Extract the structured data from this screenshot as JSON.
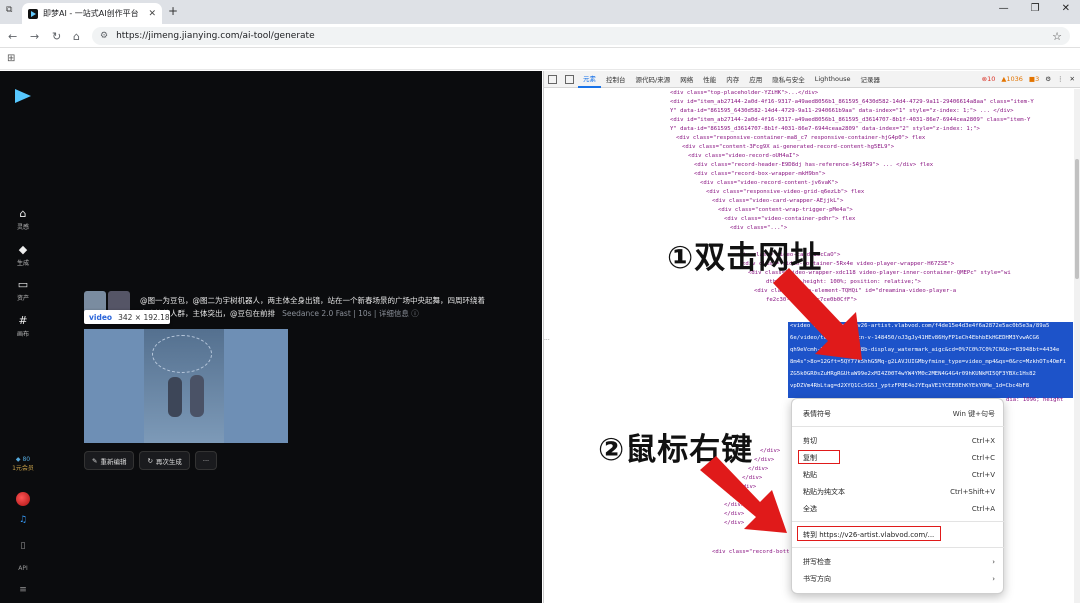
{
  "browser": {
    "tab_title": "即梦AI - 一站式AI创作平台",
    "url": "https://jimeng.jianying.com/ai-tool/generate"
  },
  "sidebar": {
    "items": [
      {
        "icon": "home-icon",
        "label": "灵感"
      },
      {
        "icon": "sparkle-icon",
        "label": "生成"
      },
      {
        "icon": "folder-icon",
        "label": "资产"
      },
      {
        "icon": "canvas-icon",
        "label": "画布"
      }
    ],
    "credits_value": "80",
    "credits_label": "1元会员",
    "api_label": "API"
  },
  "generation": {
    "prompt": "@图一为豆包，@图二为宇树机器人，两主体全身出镜，站在一个新春场景的广场中央起舞，四周环绕着喜欢笑的人群，主体突出，@豆包在前排",
    "model": "Seedance 2.0 Fast",
    "duration": "10s",
    "details_label": "详细信息",
    "tooltip_tag": "video",
    "tooltip_size": "342 × 192.18",
    "actions": [
      "重新编辑",
      "再次生成",
      "···"
    ]
  },
  "devtools": {
    "tabs": [
      "元素",
      "控制台",
      "源代码/来源",
      "网络",
      "性能",
      "内存",
      "应用",
      "隐私与安全",
      "Lighthouse",
      "记录器"
    ],
    "errors": "10",
    "warnings": "1036",
    "infos": "3",
    "lines": [
      "<div class=\"top-placeholder-YZiHK\">...</div>",
      "<div id=\"item_ab27144-2a0d-4f16-9317-a49aed8056b1_861595_6430d582-14d4-4729-9a11-29406614a8aa\" class=\"item-Y",
      "   Y\" data-id=\"861595_6430d582-14d4-4729-9a11-2940661b9aa\" data-index=\"1\" style=\"z-index: 1;\"> ... </div>",
      "<div id=\"item_ab27144-2a0d-4f16-9317-a49aed8056b1_861595_d3614707-8b1f-4031-86e7-6944cea2809\" class=\"item-Y",
      "   Y\" data-id=\"861595_d3614707-8b1f-4031-86e7-6944ceaa2809\" data-index=\"2\" style=\"z-index: 1;\">",
      "<div class=\"responsive-container-ma8_c7 responsive-container-hjG4p0\"> flex",
      "<div class=\"content-3Fcg9X ai-generated-record-content-hg5EL9\">",
      "<div class=\"video-record-oUH4aI\">",
      "<div class=\"record-header-E9D8dj has-reference-S4j5R9\"> ... </div> flex",
      "<div class=\"record-box-wrapper-mkH9bn\">",
      "<div class=\"video-record-content-jv6vaK\">",
      "<div class=\"responsive-video-grid-q6ezLb\"> flex",
      "<div class=\"video-card-wrapper-AEjjkL\">",
      "<div class=\"content-wrap-trigger-pMe4a\">",
      "<div class=\"video-container-pdhr\"> flex",
      "<div class=\"...\">",
      "<div class=\"video-card-3scCaO\">",
      "<div class=\"video-container-5Rx4e video-player-wrapper-H67ZSE\">",
      "<div class=\"video-wrapper-xdc118 video-player-inner-container-QMEPc\" style=\"wi",
      "dth: 100%; height: 100%; position: relative;\">",
      "<div class=\"video-element-TQHQi\" id=\"dreamina-video-player-a",
      "fe2c30-ec48dfb3c7ce0b0CfF\">"
    ],
    "selected_lines": [
      "<video src=\"https://v26-artist.vlabvod.com/f4de15e4d3e4f6a2872e5ac0b5e3a/89a5",
      "6e/video/tos/cn/tos-cn-v-148450/oJ3gJy41HEv86HyFP1eCh4EbhbEkHGEDHM3YvwACG6",
      "qh9eVcmh-148zv=4800-e8b-display_watermark_aigc&cd=0%7C0%7C0%7C0&br=83948bt=4434e",
      "8m4s\">8o=12Gft=5QY77k5hhG5Mq-g2LAVJUIGMbyfmine_type=video_mp4&qs=0&rc=MzkhOTs4OmFi",
      "ZG5k0GR0sZuHRgRGUtaW99e2xMI4Z00T4wYW4YM0c2MEN4G4G4r09hKUNkMI5QF3YBXc1Hs82",
      "vpDZVm4RbLtag=d2XYQ1Cc5G5J_yptzFP8E4oJYEqaVE1YCEE0EhKYEkYOMe_1d=Cbc4bF8"
    ],
    "after_sel_line": "dia: 1096; height",
    "closing_lines": [
      "</div>",
      "</div>",
      "</div>",
      "</div>",
      "</div>",
      "</div>",
      "</div>",
      "</div>",
      "</div>"
    ],
    "footer_line": "<div class=\"record-bott"
  },
  "context_menu": {
    "items": [
      {
        "label": "表情符号",
        "key": "Win 键+句号"
      },
      {
        "label": "剪切",
        "key": "Ctrl+X"
      },
      {
        "label": "复制",
        "key": "Ctrl+C"
      },
      {
        "label": "粘贴",
        "key": "Ctrl+V"
      },
      {
        "label": "粘贴为纯文本",
        "key": "Ctrl+Shift+V"
      },
      {
        "label": "全选",
        "key": "Ctrl+A"
      },
      {
        "label": "转到 https://v26-artist.vlabvod.com/...",
        "key": ""
      },
      {
        "label": "拼写检查",
        "key": "›"
      },
      {
        "label": "书写方向",
        "key": "›"
      }
    ]
  },
  "annotations": {
    "step1": "①双击网址",
    "step2": "②鼠标右键",
    "accent_color": "#e01a1a"
  }
}
